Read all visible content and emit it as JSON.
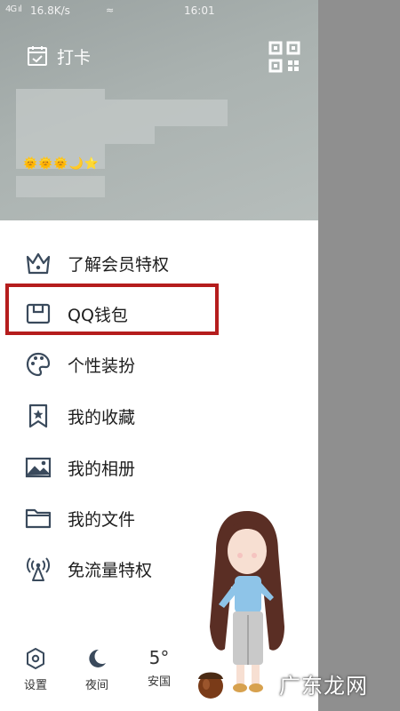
{
  "status_bar": {
    "signal": "4G ıl",
    "network_speed": "16.8K/s",
    "wifi_symbol": "≈",
    "time": "16:01"
  },
  "header": {
    "checkin_label": "打卡",
    "level_badges": "🌞🌞🌞🌙⭐"
  },
  "menu": {
    "items": [
      {
        "label": "了解会员特权",
        "icon": "crown-icon"
      },
      {
        "label": "QQ钱包",
        "icon": "wallet-icon"
      },
      {
        "label": "个性装扮",
        "icon": "palette-icon"
      },
      {
        "label": "我的收藏",
        "icon": "bookmark-icon"
      },
      {
        "label": "我的相册",
        "icon": "image-icon"
      },
      {
        "label": "我的文件",
        "icon": "folder-icon"
      },
      {
        "label": "免流量特权",
        "icon": "antenna-icon"
      }
    ]
  },
  "bottom_bar": {
    "settings_label": "设置",
    "night_label": "夜间",
    "weather_temp": "5°",
    "weather_city": "安国"
  },
  "highlight_color": "#b51d1d",
  "watermark": "广东龙网"
}
